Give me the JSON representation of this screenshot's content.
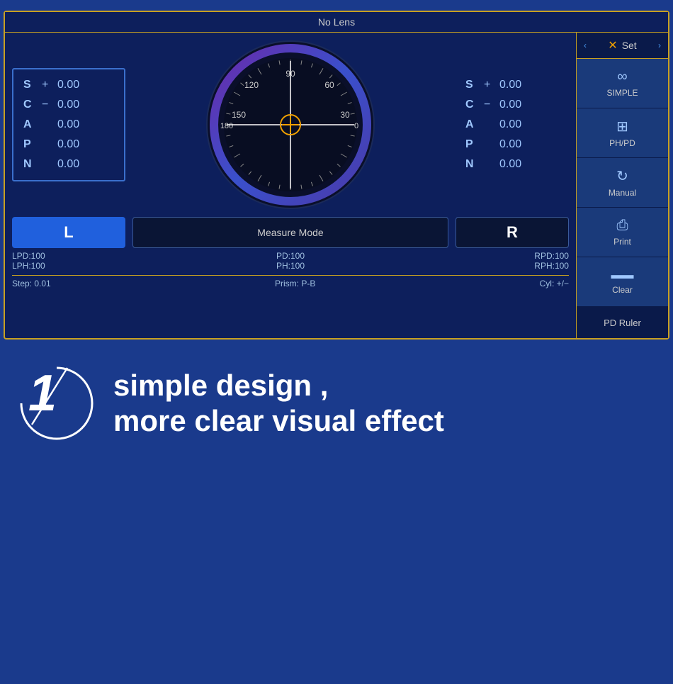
{
  "panel": {
    "header": "No Lens",
    "sidebar_header": "Set",
    "left": {
      "rows": [
        {
          "label": "S",
          "sign": "+",
          "value": "0.00"
        },
        {
          "label": "C",
          "sign": "−",
          "value": "0.00"
        },
        {
          "label": "A",
          "sign": " ",
          "value": "0.00"
        },
        {
          "label": "P",
          "sign": " ",
          "value": "0.00"
        },
        {
          "label": "N",
          "sign": " ",
          "value": "0.00"
        }
      ]
    },
    "right": {
      "rows": [
        {
          "label": "S",
          "sign": "+",
          "value": "0.00"
        },
        {
          "label": "C",
          "sign": "−",
          "value": "0.00"
        },
        {
          "label": "A",
          "sign": " ",
          "value": "0.00"
        },
        {
          "label": "P",
          "sign": " ",
          "value": "0.00"
        },
        {
          "label": "N",
          "sign": " ",
          "value": "0.00"
        }
      ]
    },
    "buttons": {
      "L": "L",
      "measure_mode": "Measure Mode",
      "R": "R"
    },
    "pd_info": {
      "left_lpd": "LPD:100",
      "left_lph": "LPH:100",
      "center_pd": "PD:100",
      "center_ph": "PH:100",
      "right_rpd": "RPD:100",
      "right_rph": "RPH:100"
    },
    "status": {
      "step": "Step:  0.01",
      "prism": "Prism:  P-B",
      "cyl": "Cyl:  +/−"
    },
    "sidebar_buttons": [
      {
        "id": "simple",
        "icon": "∞",
        "label": "SIMPLE"
      },
      {
        "id": "phpd",
        "icon": "⊞",
        "label": "PH/PD"
      },
      {
        "id": "manual",
        "icon": "↻",
        "label": "Manual"
      },
      {
        "id": "print",
        "icon": "⎙",
        "label": "Print"
      },
      {
        "id": "clear",
        "icon": "▬",
        "label": "Clear"
      }
    ],
    "pd_ruler": "PD  Ruler"
  },
  "bottom": {
    "number": "1",
    "tagline1": "simple design ,",
    "tagline2": "more clear visual effect"
  }
}
